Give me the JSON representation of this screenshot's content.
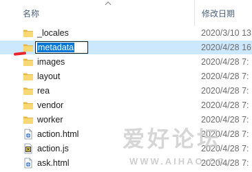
{
  "header": {
    "name_label": "名称",
    "date_label": "修改日期"
  },
  "rows": [
    {
      "name": "_locales",
      "date": "2020/3/10 13",
      "icon": "folder-icon",
      "selected": false
    },
    {
      "name": "metadata",
      "date": "2020/4/28 16",
      "icon": "folder-icon",
      "selected": true,
      "renaming": true
    },
    {
      "name": "images",
      "date": "2020/4/28 7:",
      "icon": "folder-icon",
      "selected": false
    },
    {
      "name": "layout",
      "date": "2020/4/28 7:",
      "icon": "folder-icon",
      "selected": false
    },
    {
      "name": "rea",
      "date": "2020/4/28 7:",
      "icon": "folder-icon",
      "selected": false
    },
    {
      "name": "vendor",
      "date": "2020/4/28 7:",
      "icon": "folder-icon",
      "selected": false
    },
    {
      "name": "worker",
      "date": "2020/4/28 7:",
      "icon": "folder-icon",
      "selected": false
    },
    {
      "name": "action.html",
      "date": "2020/4/28 7:",
      "icon": "html-file-icon",
      "selected": false
    },
    {
      "name": "action.js",
      "date": "2020/4/28 7:",
      "icon": "js-file-icon",
      "selected": false
    },
    {
      "name": "ask.html",
      "date": "2020/4/28 7:",
      "icon": "html-file-icon",
      "selected": false
    }
  ],
  "watermark": {
    "text": "爱好论坛",
    "url": "WWW.AIHAO.CC"
  },
  "colors": {
    "selection": "#cce8ff",
    "rename_highlight": "#0078d7",
    "folder": "#f8d775",
    "annotation": "#e8262b"
  }
}
